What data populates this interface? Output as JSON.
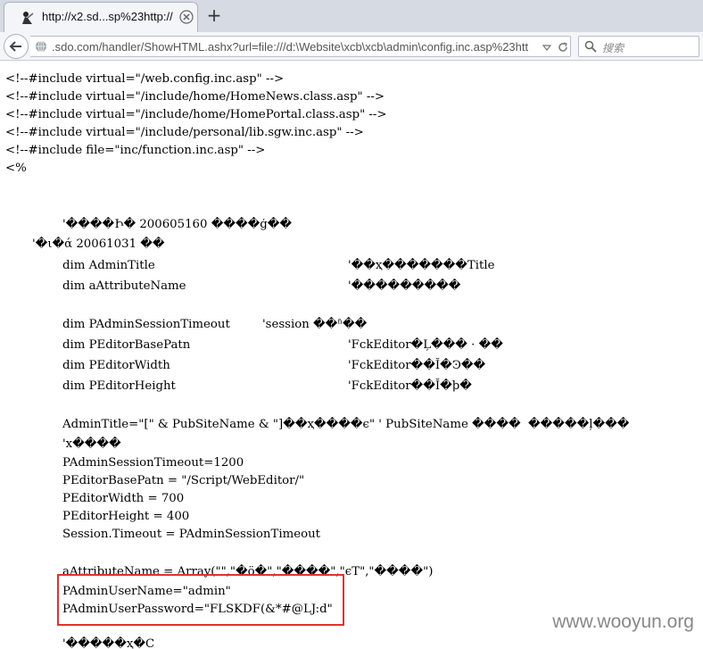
{
  "browser": {
    "tab_title": "http://x2.sd...sp%23http://",
    "new_tab": "+",
    "url": ".sdo.com/handler/ShowHTML.ashx?url=file:///d:\\Website\\xcb\\xcb\\admin\\config.inc.asp%23htt",
    "search_placeholder": "搜索"
  },
  "source_lines": [
    "<!--#include virtual=\"/web.config.inc.asp\" -->",
    "<!--#include virtual=\"/include/home/HomeNews.class.asp\" -->",
    "<!--#include virtual=\"/include/home/HomePortal.class.asp\" -->",
    "<!--#include virtual=\"/include/personal/lib.sgw.inc.asp\" -->",
    "<!--#include file=\"inc/function.inc.asp\" -->",
    "<%",
    "'����Ի� 200605160 ����ģ��",
    "'�ι�ά 20061031 ��",
    "dim AdminTitle",
    "'��ҳ�������Title",
    "dim aAttributeName",
    "'���������",
    "dim PAdminSessionTimeout",
    "'session ��ʱ��",
    "dim PEditorBasePatn",
    "'FckEditor�Ļ��� · ��",
    "dim PEditorWidth",
    "'FckEditor��Ĭ�Ͽ��",
    "dim PEditorHeight",
    "'FckEditor��Ĭ�ϸ�",
    "AdminTitle=\"[\" & PubSiteName & \"]��ҳ����ϵ\" ' PubSiteName ����  �����ļ���",
    "'x����",
    "PAdminSessionTimeout=1200",
    "PEditorBasePatn = \"/Script/WebEditor/\"",
    "PEditorWidth = 700",
    "PEditorHeight = 400",
    "Session.Timeout = PAdminSessionTimeout",
    "aAttributeName = Array(\"\",\"�ö�\",\"����\",\"ϵT\",\"����\")",
    "PAdminUserName=\"admin\"",
    "PAdminUserPassword=\"FLSKDF(&*#@LJ:d\"",
    "'�����ҳ�C"
  ],
  "watermark": "www.wooyun.org",
  "colors": {
    "highlight_box": "#e53030",
    "tabbar_bg": "#d6dbe3"
  }
}
